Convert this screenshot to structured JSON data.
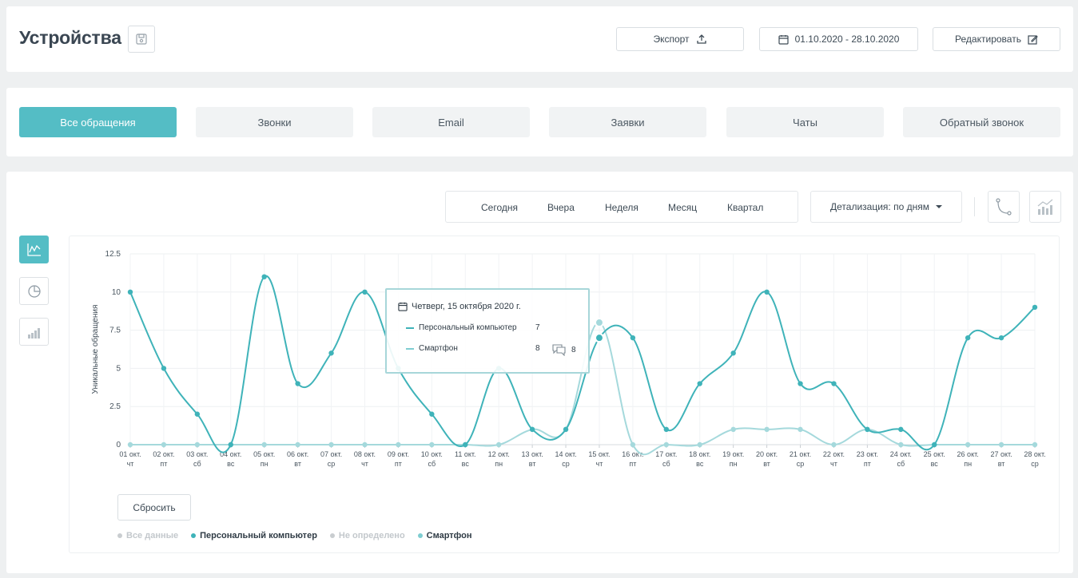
{
  "header": {
    "title": "Устройства",
    "export_label": "Экспорт",
    "date_range": "01.10.2020 - 28.10.2020",
    "edit_label": "Редактировать"
  },
  "tabs": [
    {
      "label": "Все обращения",
      "active": true
    },
    {
      "label": "Звонки"
    },
    {
      "label": "Email"
    },
    {
      "label": "Заявки"
    },
    {
      "label": "Чаты"
    },
    {
      "label": "Обратный звонок"
    }
  ],
  "periods": [
    "Сегодня",
    "Вчера",
    "Неделя",
    "Месяц",
    "Квартал"
  ],
  "detail_label": "Детализация: по дням",
  "reset_label": "Сбросить",
  "legend": [
    {
      "label": "Все данные",
      "color": "#c9cdd0",
      "active": false
    },
    {
      "label": "Персональный компьютер",
      "color": "#3fb3b9",
      "active": true
    },
    {
      "label": "Не определено",
      "color": "#c9cdd0",
      "active": false
    },
    {
      "label": "Смартфон",
      "color": "#7ecdd1",
      "active": true
    }
  ],
  "tooltip": {
    "date": "Четверг, 15 октября 2020 г.",
    "rows": [
      {
        "label": "Персональный компьютер",
        "value": "7",
        "color": "#3fb3b9"
      },
      {
        "label": "Смартфон",
        "value": "8",
        "color": "#7ecdd1"
      }
    ],
    "comments": "8"
  },
  "chart_data": {
    "type": "line",
    "ylabel": "Уникальные обращения",
    "ylim": [
      0,
      12.5
    ],
    "yticks": [
      "0",
      "2.5",
      "5",
      "7.5",
      "10",
      "12.5"
    ],
    "categories": [
      [
        "01 окт.",
        "чт"
      ],
      [
        "02 окт.",
        "пт"
      ],
      [
        "03 окт.",
        "сб"
      ],
      [
        "04 окт.",
        "вс"
      ],
      [
        "05 окт.",
        "пн"
      ],
      [
        "06 окт.",
        "вт"
      ],
      [
        "07 окт.",
        "ср"
      ],
      [
        "08 окт.",
        "чт"
      ],
      [
        "09 окт.",
        "пт"
      ],
      [
        "10 окт.",
        "сб"
      ],
      [
        "11 окт.",
        "вс"
      ],
      [
        "12 окт.",
        "пн"
      ],
      [
        "13 окт.",
        "вт"
      ],
      [
        "14 окт.",
        "ср"
      ],
      [
        "15 окт.",
        "чт"
      ],
      [
        "16 окт.",
        "пт"
      ],
      [
        "17 окт.",
        "сб"
      ],
      [
        "18 окт.",
        "вс"
      ],
      [
        "19 окт.",
        "пн"
      ],
      [
        "20 окт.",
        "вт"
      ],
      [
        "21 окт.",
        "ср"
      ],
      [
        "22 окт.",
        "чт"
      ],
      [
        "23 окт.",
        "пт"
      ],
      [
        "24 окт.",
        "сб"
      ],
      [
        "25 окт.",
        "вс"
      ],
      [
        "26 окт.",
        "пн"
      ],
      [
        "27 окт.",
        "вт"
      ],
      [
        "28 окт.",
        "ср"
      ]
    ],
    "series": [
      {
        "name": "Персональный компьютер",
        "color": "#3fb3b9",
        "values": [
          10,
          5,
          2,
          0,
          11,
          4,
          6,
          10,
          5,
          2,
          0,
          5,
          1,
          1,
          7,
          7,
          1,
          4,
          6,
          10,
          4,
          4,
          1,
          1,
          0,
          7,
          7,
          9
        ]
      },
      {
        "name": "Смартфон",
        "color": "#a5d9dc",
        "values": [
          0,
          0,
          0,
          0,
          0,
          0,
          0,
          0,
          0,
          0,
          0,
          0,
          1,
          1,
          8,
          0,
          0,
          0,
          1,
          1,
          1,
          0,
          1,
          0,
          0,
          0,
          0,
          0
        ]
      }
    ],
    "highlight_index": 14,
    "grid": true
  }
}
